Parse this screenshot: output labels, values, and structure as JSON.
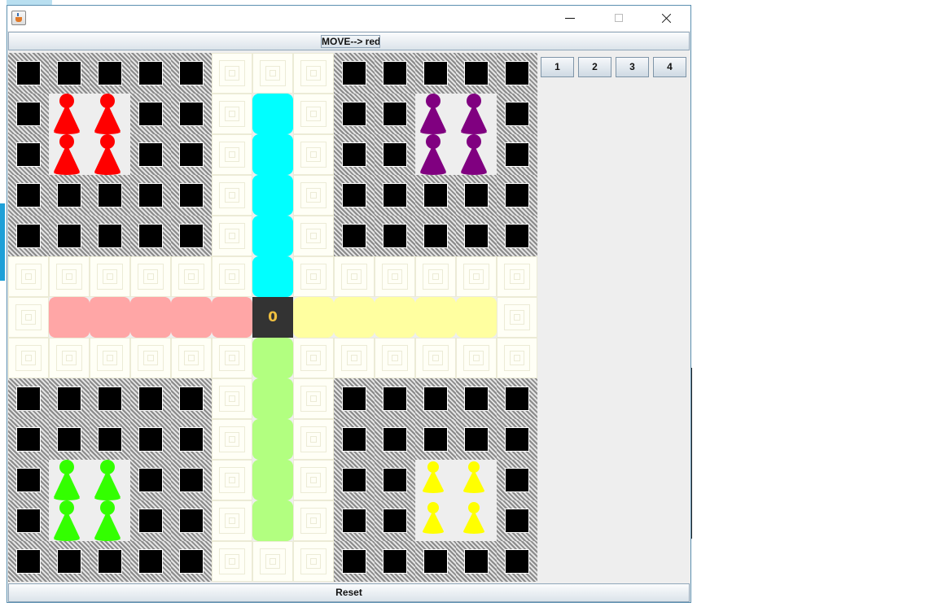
{
  "window": {
    "title": "",
    "controls": [
      "minimize",
      "maximize",
      "close"
    ]
  },
  "status": {
    "move_label": "MOVE--> red"
  },
  "board": {
    "center_value": "0",
    "lanes": {
      "top": "#00ffff",
      "left": "#ffa6a6",
      "right": "#ffffa0",
      "bottom": "#b2ff80"
    },
    "players": [
      {
        "color": "red",
        "hex": "#ff0000",
        "pawns_in_home": 4
      },
      {
        "color": "purple",
        "hex": "#800080",
        "pawns_in_home": 4
      },
      {
        "color": "green",
        "hex": "#33ff00",
        "pawns_in_home": 4
      },
      {
        "color": "yellow",
        "hex": "#ffff00",
        "pawns_in_home": 4
      }
    ]
  },
  "dice_buttons": [
    "1",
    "2",
    "3",
    "4"
  ],
  "footer": {
    "reset_label": "Reset"
  },
  "colors": {
    "window_bg": "#eeeeee",
    "center_bg": "#333333",
    "center_text": "#f0c040"
  }
}
